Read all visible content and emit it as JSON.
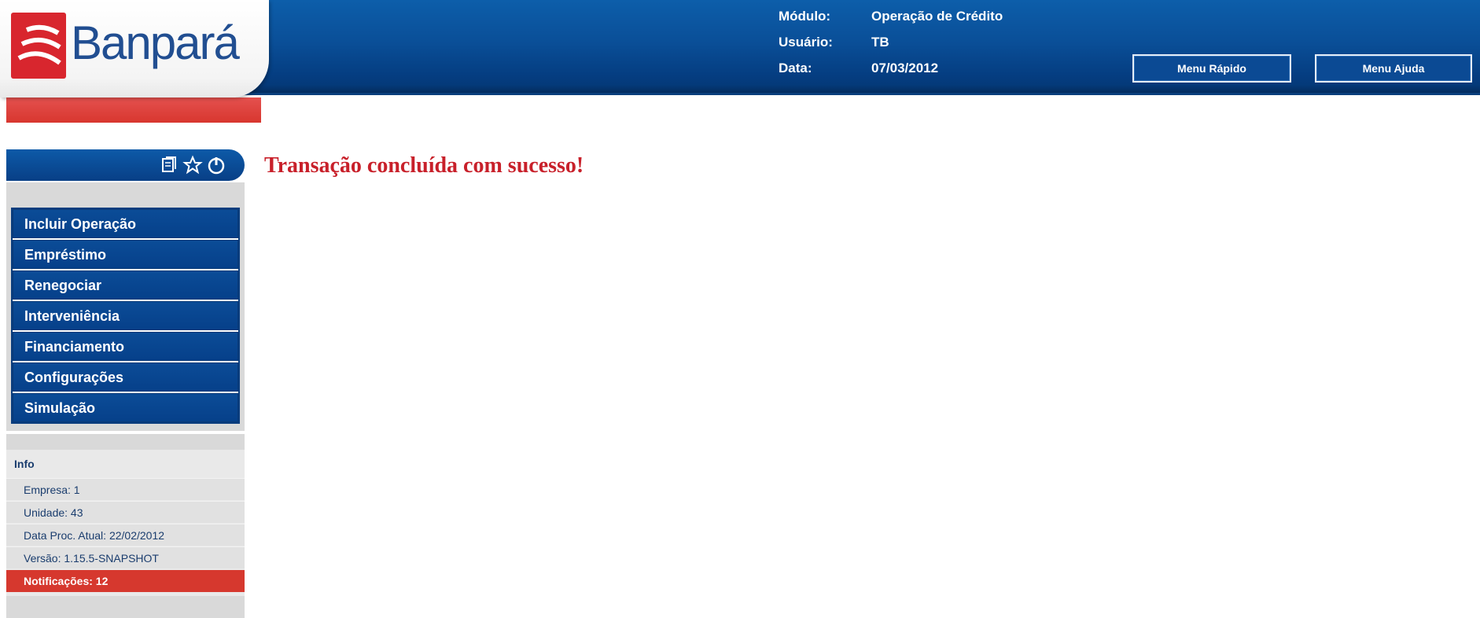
{
  "header": {
    "logo_text": "Banpará",
    "info": [
      {
        "label": "Módulo:",
        "value": "Operação de Crédito"
      },
      {
        "label": "Usuário:",
        "value": "TB"
      },
      {
        "label": "Data:",
        "value": "07/03/2012"
      }
    ],
    "buttons": {
      "menu_rapido": "Menu Rápido",
      "menu_ajuda": "Menu Ajuda"
    }
  },
  "sidebar": {
    "toolbar_icons": [
      "documents-icon",
      "star-icon",
      "power-icon"
    ],
    "menu": [
      {
        "label": "Incluir Operação"
      },
      {
        "label": "Empréstimo"
      },
      {
        "label": "Renegociar"
      },
      {
        "label": "Interveniência"
      },
      {
        "label": "Financiamento"
      },
      {
        "label": "Configurações"
      },
      {
        "label": "Simulação"
      }
    ],
    "info": {
      "title": "Info",
      "empresa": "Empresa: 1",
      "unidade": "Unidade: 43",
      "data_proc": "Data Proc. Atual: 22/02/2012",
      "versao": "Versão: 1.15.5-SNAPSHOT",
      "notificacoes": "Notificações: 12"
    }
  },
  "main": {
    "message": "Transação concluída com sucesso!"
  },
  "colors": {
    "header_blue": "#0a4f98",
    "menu_blue": "#0b4c97",
    "brand_red": "#d8262e",
    "message_red": "#c8202a"
  }
}
